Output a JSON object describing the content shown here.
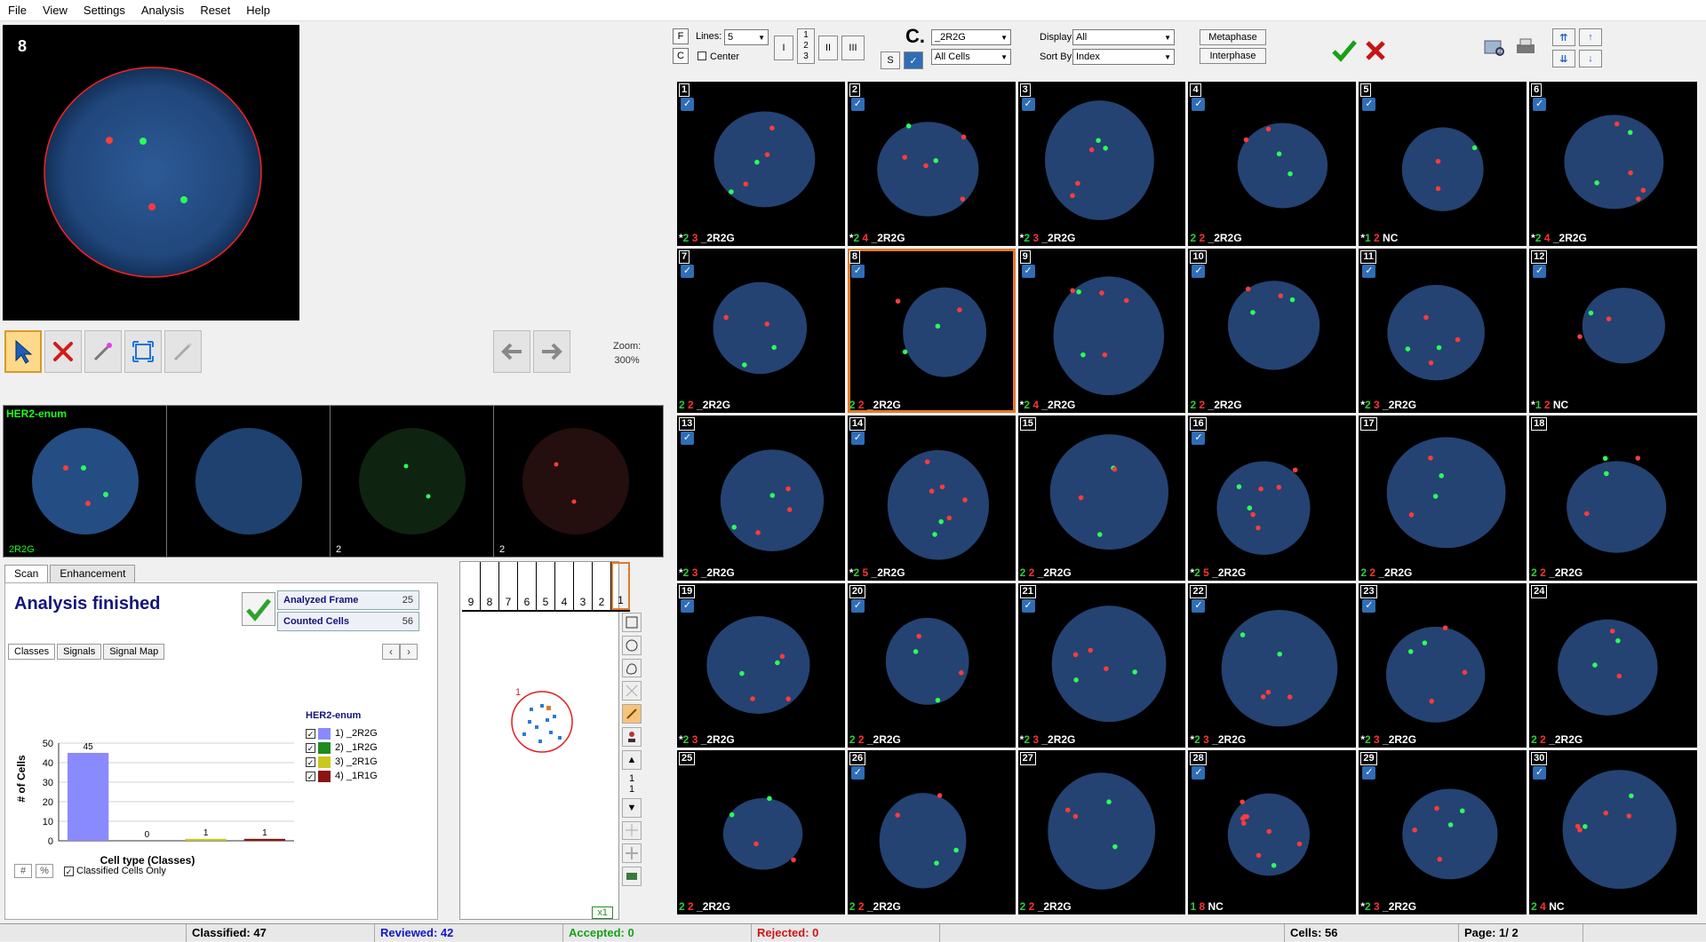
{
  "menu": [
    "File",
    "View",
    "Settings",
    "Analysis",
    "Reset",
    "Help"
  ],
  "main_image": {
    "index": "8"
  },
  "zoom": {
    "label": "Zoom:",
    "value": "300%"
  },
  "channels": [
    {
      "title": "HER2-enum",
      "label": "2R2G"
    },
    {
      "title": "",
      "label": ""
    },
    {
      "title": "",
      "label": "2"
    },
    {
      "title": "",
      "label": "2"
    }
  ],
  "tabs": [
    "Scan",
    "Enhancement"
  ],
  "scan": {
    "status": "Analysis finished",
    "analyzed_frame_label": "Analyzed Frame",
    "analyzed_frame_value": "25",
    "counted_cells_label": "Counted Cells",
    "counted_cells_value": "56"
  },
  "subtabs": [
    "Classes",
    "Signals",
    "Signal Map"
  ],
  "chart_data": {
    "type": "bar",
    "categories": [
      "1) _2R2G",
      "2) _1R2G",
      "3) _2R1G",
      "4) _1R1G"
    ],
    "values": [
      45,
      0,
      1,
      1
    ],
    "colors": [
      "#8a8aff",
      "#1e8c1e",
      "#c8c81e",
      "#8c1414"
    ],
    "xlabel": "Cell type (Classes)",
    "ylabel": "# of Cells",
    "ylim": [
      0,
      50
    ],
    "yticks": [
      0,
      10,
      20,
      30,
      40,
      50
    ],
    "legend_title": "HER2-enum",
    "grid": true
  },
  "options": {
    "abs_btn": "#",
    "pct_btn": "%",
    "classified_only": "Classified Cells Only"
  },
  "frame_map": {
    "frames": [
      "9",
      "8",
      "7",
      "6",
      "5",
      "4",
      "3",
      "2",
      "1"
    ],
    "selected": "",
    "scale": "x1",
    "marker": "1"
  },
  "map_tools_text": [
    "1",
    "1"
  ],
  "toolbar": {
    "f_btn": "F",
    "c_btn": "C",
    "lines_label": "Lines:",
    "lines_value": "5",
    "center_label": "Center",
    "cols": [
      "1",
      "2",
      "3"
    ],
    "mode_i": "I",
    "mode_ii": "II",
    "mode_iii": "III",
    "s_btn": "S",
    "class_sel": "_2R2G",
    "cells_sel": "All Cells",
    "display_label": "Display:",
    "display_value": "All",
    "sortby_label": "Sort By:",
    "sortby_value": "Index",
    "metaphase": "Metaphase",
    "interphase": "Interphase",
    "c_big": "C."
  },
  "cells": [
    {
      "n": "1",
      "star": "*",
      "g": "2",
      "r": "3",
      "cls": "_2R2G",
      "chk": true
    },
    {
      "n": "2",
      "star": "*",
      "g": "2",
      "r": "4",
      "cls": "_2R2G",
      "chk": true
    },
    {
      "n": "3",
      "star": "*",
      "g": "2",
      "r": "3",
      "cls": "_2R2G",
      "chk": true
    },
    {
      "n": "4",
      "star": "",
      "g": "2",
      "r": "2",
      "cls": "_2R2G",
      "chk": true
    },
    {
      "n": "5",
      "star": "*",
      "g": "1",
      "r": "2",
      "cls": "NC",
      "chk": true
    },
    {
      "n": "6",
      "star": "*",
      "g": "2",
      "r": "4",
      "cls": "_2R2G",
      "chk": true
    },
    {
      "n": "7",
      "star": "",
      "g": "2",
      "r": "2",
      "cls": "_2R2G",
      "chk": true
    },
    {
      "n": "8",
      "star": "",
      "g": "2",
      "r": "2",
      "cls": "_2R2G",
      "chk": true
    },
    {
      "n": "9",
      "star": "*",
      "g": "2",
      "r": "4",
      "cls": "_2R2G",
      "chk": true
    },
    {
      "n": "10",
      "star": "",
      "g": "2",
      "r": "2",
      "cls": "_2R2G",
      "chk": true
    },
    {
      "n": "11",
      "star": "*",
      "g": "2",
      "r": "3",
      "cls": "_2R2G",
      "chk": true
    },
    {
      "n": "12",
      "star": "*",
      "g": "1",
      "r": "2",
      "cls": "NC",
      "chk": true
    },
    {
      "n": "13",
      "star": "*",
      "g": "2",
      "r": "3",
      "cls": "_2R2G",
      "chk": true
    },
    {
      "n": "14",
      "star": "*",
      "g": "2",
      "r": "5",
      "cls": "_2R2G",
      "chk": true
    },
    {
      "n": "15",
      "star": "",
      "g": "2",
      "r": "2",
      "cls": "_2R2G",
      "chk": false
    },
    {
      "n": "16",
      "star": "*",
      "g": "2",
      "r": "5",
      "cls": "_2R2G",
      "chk": true
    },
    {
      "n": "17",
      "star": "",
      "g": "2",
      "r": "2",
      "cls": "_2R2G",
      "chk": false
    },
    {
      "n": "18",
      "star": "",
      "g": "2",
      "r": "2",
      "cls": "_2R2G",
      "chk": false
    },
    {
      "n": "19",
      "star": "*",
      "g": "2",
      "r": "3",
      "cls": "_2R2G",
      "chk": true
    },
    {
      "n": "20",
      "star": "",
      "g": "2",
      "r": "2",
      "cls": "_2R2G",
      "chk": true
    },
    {
      "n": "21",
      "star": "*",
      "g": "2",
      "r": "3",
      "cls": "_2R2G",
      "chk": true
    },
    {
      "n": "22",
      "star": "*",
      "g": "2",
      "r": "3",
      "cls": "_2R2G",
      "chk": true
    },
    {
      "n": "23",
      "star": "*",
      "g": "2",
      "r": "3",
      "cls": "_2R2G",
      "chk": true
    },
    {
      "n": "24",
      "star": "",
      "g": "2",
      "r": "2",
      "cls": "_2R2G",
      "chk": false
    },
    {
      "n": "25",
      "star": "",
      "g": "2",
      "r": "2",
      "cls": "_2R2G",
      "chk": false
    },
    {
      "n": "26",
      "star": "",
      "g": "2",
      "r": "2",
      "cls": "_2R2G",
      "chk": true
    },
    {
      "n": "27",
      "star": "",
      "g": "2",
      "r": "2",
      "cls": "_2R2G",
      "chk": false
    },
    {
      "n": "28",
      "star": "",
      "g": "1",
      "r": "8",
      "cls": "NC",
      "chk": true
    },
    {
      "n": "29",
      "star": "*",
      "g": "2",
      "r": "3",
      "cls": "_2R2G",
      "chk": true
    },
    {
      "n": "30",
      "star": "",
      "g": "2",
      "r": "4",
      "cls": "NC",
      "chk": true
    }
  ],
  "status": {
    "classified": "Classified:  47",
    "reviewed": "Reviewed:  42",
    "accepted": "Accepted:   0",
    "rejected": "Rejected:   0",
    "cells": "Cells:  56",
    "page": "Page:  1/  2"
  },
  "colors": {
    "accent": "#e07a2a",
    "nucleus": "#2a4f86",
    "title": "#14147a"
  }
}
